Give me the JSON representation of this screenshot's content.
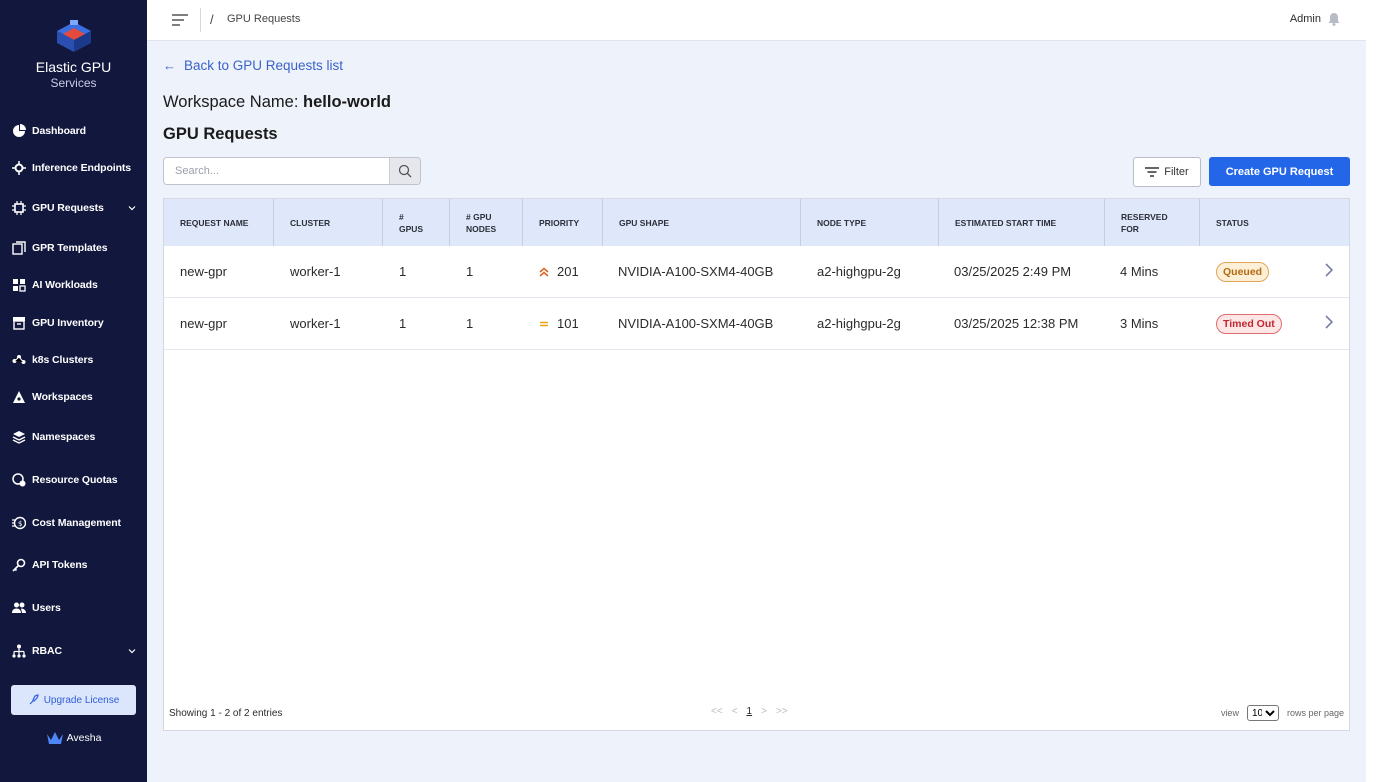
{
  "brand": {
    "title": "Elastic GPU",
    "subtitle": "Services"
  },
  "sidebar": {
    "items": [
      {
        "label": "Dashboard",
        "icon": "pie-chart-icon"
      },
      {
        "label": "Inference Endpoints",
        "icon": "gear-network-icon"
      },
      {
        "label": "GPU Requests",
        "icon": "chip-icon",
        "expandable": true
      },
      {
        "label": "GPR Templates",
        "icon": "template-icon"
      },
      {
        "label": "AI Workloads",
        "icon": "workloads-icon"
      },
      {
        "label": "GPU Inventory",
        "icon": "inventory-icon"
      },
      {
        "label": "k8s Clusters",
        "icon": "cluster-icon"
      },
      {
        "label": "Workspaces",
        "icon": "workspace-icon"
      },
      {
        "label": "Namespaces",
        "icon": "layers-icon"
      },
      {
        "label": "Resource Quotas",
        "icon": "quota-icon"
      },
      {
        "label": "Cost Management",
        "icon": "cost-icon"
      },
      {
        "label": "API Tokens",
        "icon": "key-icon"
      },
      {
        "label": "Users",
        "icon": "users-icon"
      },
      {
        "label": "RBAC",
        "icon": "rbac-icon",
        "expandable": true
      }
    ],
    "upgrade_label": "Upgrade License",
    "footer_brand": "Avesha"
  },
  "topbar": {
    "separator": "/",
    "breadcrumb": "GPU Requests",
    "user": "Admin"
  },
  "main": {
    "back_link": "Back to GPU Requests list",
    "workspace_label": "Workspace Name:",
    "workspace_name": "hello-world",
    "section_title": "GPU Requests",
    "search_placeholder": "Search...",
    "filter_label": "Filter",
    "create_label": "Create GPU Request"
  },
  "table": {
    "columns": {
      "name": "REQUEST NAME",
      "cluster": "CLUSTER",
      "gpus_1": "#",
      "gpus_2": "GPUS",
      "nodes_1": "# GPU",
      "nodes_2": "NODES",
      "priority": "PRIORITY",
      "shape": "GPU SHAPE",
      "node_type": "NODE TYPE",
      "start": "ESTIMATED START TIME",
      "reserved_1": "RESERVED",
      "reserved_2": "FOR",
      "status": "STATUS"
    },
    "rows": [
      {
        "name": "new-gpr",
        "cluster": "worker-1",
        "gpus": "1",
        "nodes": "1",
        "priority": "201",
        "priority_icon": "double-chevron-up-icon",
        "shape": "NVIDIA-A100-SXM4-40GB",
        "node_type": "a2-highgpu-2g",
        "start": "03/25/2025 2:49 PM",
        "reserved": "4 Mins",
        "status": "Queued"
      },
      {
        "name": "new-gpr",
        "cluster": "worker-1",
        "gpus": "1",
        "nodes": "1",
        "priority": "101",
        "priority_icon": "equals-icon",
        "shape": "NVIDIA-A100-SXM4-40GB",
        "node_type": "a2-highgpu-2g",
        "start": "03/25/2025 12:38 PM",
        "reserved": "3 Mins",
        "status": "Timed Out"
      }
    ],
    "footer": {
      "showing": "Showing 1 - 2 of 2 entries",
      "first": "<<",
      "prev": "<",
      "page": "1",
      "next": ">",
      "last": ">>",
      "view_label": "view",
      "rows_value": "10",
      "rows_label": "rows per page"
    }
  },
  "colors": {
    "sidebar_bg": "#12173d",
    "primary": "#2367e8",
    "queued": "#b46a10",
    "timed_out": "#c2272f",
    "priority_high": "#e0631c",
    "priority_medium": "#e8a317"
  }
}
